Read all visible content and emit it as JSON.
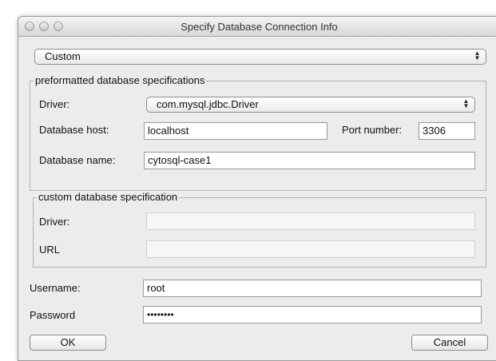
{
  "window": {
    "title": "Specify Database Connection Info"
  },
  "profile_select": {
    "value": "Custom"
  },
  "preformatted": {
    "legend": "preformatted database specifications",
    "driver_label": "Driver:",
    "driver_value": "com.mysql.jdbc.Driver",
    "host_label": "Database host:",
    "host_value": "localhost",
    "port_label": "Port number:",
    "port_value": "3306",
    "name_label": "Database name:",
    "name_value": "cytosql-case1"
  },
  "custom": {
    "legend": "custom database specification",
    "driver_label": "Driver:",
    "driver_value": "",
    "url_label": "URL",
    "url_value": ""
  },
  "credentials": {
    "username_label": "Username:",
    "username_value": "root",
    "password_label": "Password",
    "password_value": "••••••••"
  },
  "buttons": {
    "ok": "OK",
    "cancel": "Cancel"
  },
  "icons": {
    "popup_arrows": "up-down-arrows-icon"
  }
}
